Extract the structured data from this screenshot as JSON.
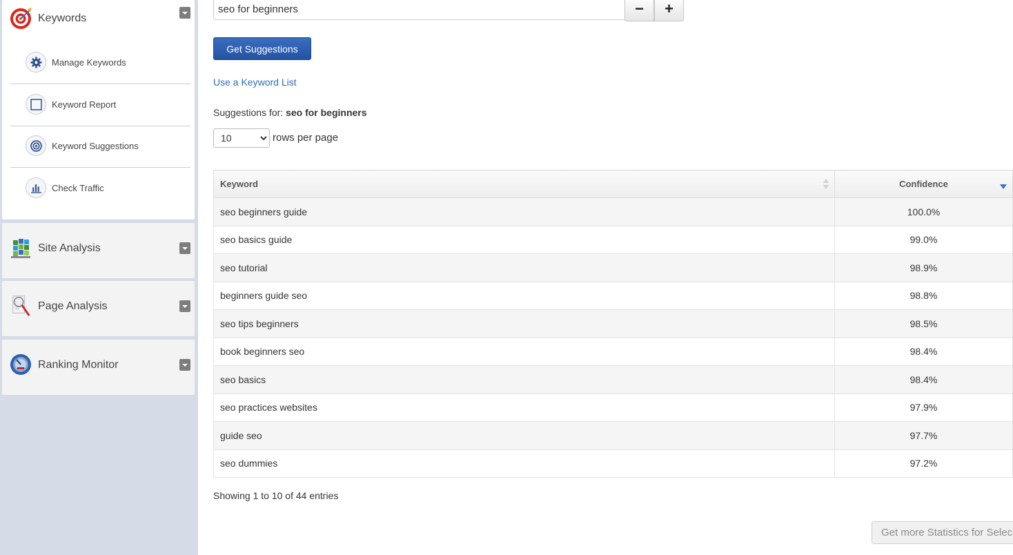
{
  "sidebar": {
    "keywords": {
      "title": "Keywords",
      "icon": "target-icon",
      "items": [
        {
          "label": "Manage Keywords",
          "icon": "gear-icon"
        },
        {
          "label": "Keyword Report",
          "icon": "square-icon"
        },
        {
          "label": "Keyword Suggestions",
          "icon": "bullseye-icon"
        },
        {
          "label": "Check Traffic",
          "icon": "bar-chart-icon"
        }
      ]
    },
    "site_analysis": {
      "title": "Site Analysis",
      "icon": "blocks-icon"
    },
    "page_analysis": {
      "title": "Page Analysis",
      "icon": "magnifier-icon"
    },
    "ranking_monitor": {
      "title": "Ranking Monitor",
      "icon": "gauge-icon"
    }
  },
  "search": {
    "value": "seo for beginners",
    "minus_label": "−",
    "plus_label": "+"
  },
  "get_suggestions_label": "Get Suggestions",
  "keyword_list_link": "Use a Keyword List",
  "suggestions": {
    "prefix": "Suggestions for: ",
    "term": "seo for beginners"
  },
  "rows_per_page": {
    "selected": "10",
    "label": "rows per page"
  },
  "table": {
    "headers": {
      "keyword": "Keyword",
      "confidence": "Confidence"
    },
    "rows": [
      {
        "keyword": "seo beginners guide",
        "confidence": "100.0%"
      },
      {
        "keyword": "seo basics guide",
        "confidence": "99.0%"
      },
      {
        "keyword": "seo tutorial",
        "confidence": "98.9%"
      },
      {
        "keyword": "beginners guide seo",
        "confidence": "98.8%"
      },
      {
        "keyword": "seo tips beginners",
        "confidence": "98.5%"
      },
      {
        "keyword": "book beginners seo",
        "confidence": "98.4%"
      },
      {
        "keyword": "seo basics",
        "confidence": "98.4%"
      },
      {
        "keyword": "seo practices websites",
        "confidence": "97.9%"
      },
      {
        "keyword": "guide seo",
        "confidence": "97.7%"
      },
      {
        "keyword": "seo dummies",
        "confidence": "97.2%"
      }
    ]
  },
  "info_text": "Showing 1 to 10 of 44 entries",
  "stats_button_label": "Get more Statistics for Selec",
  "colors": {
    "sidebar_bg": "#d5dce8",
    "primary_button": "#2452a3",
    "link": "#2a6db5",
    "sort_active": "#3a72c4"
  }
}
